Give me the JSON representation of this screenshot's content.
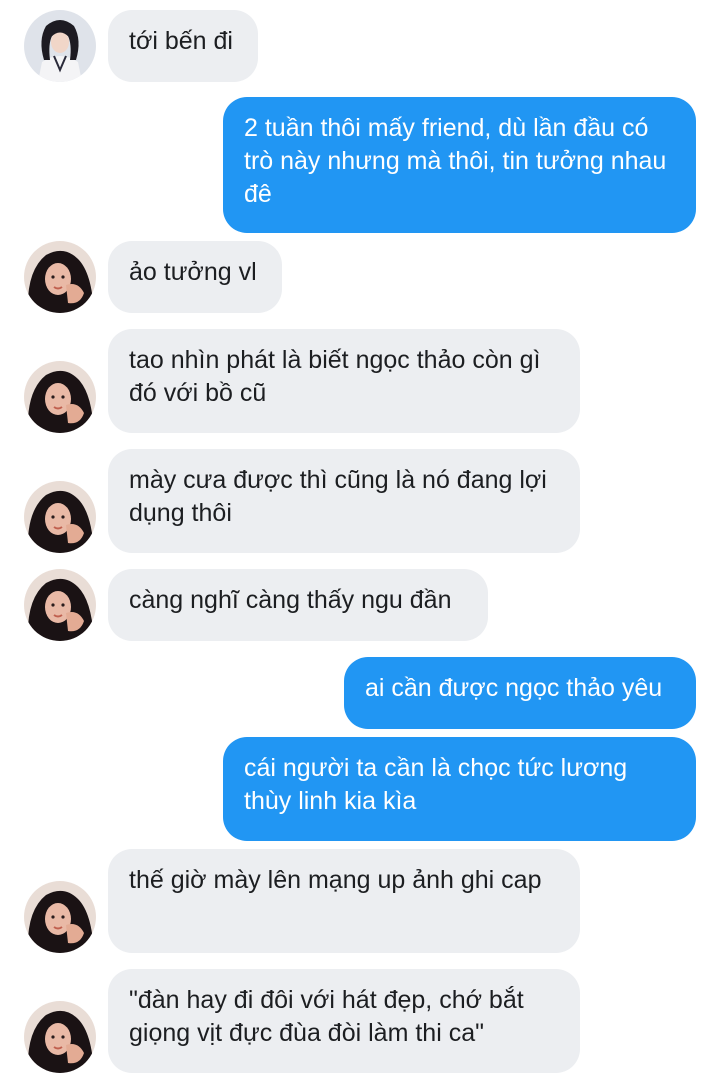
{
  "contact": {
    "avatar_first_icon": "girl-with-bangs-avatar-icon",
    "avatar_icon": "woman-portrait-avatar-icon"
  },
  "colors": {
    "incoming_bubble": "#eceef1",
    "outgoing_bubble": "#2196f3",
    "incoming_text": "#1c1e21",
    "outgoing_text": "#ffffff"
  },
  "messages": [
    {
      "side": "in",
      "text": "tới bến đi"
    },
    {
      "side": "out",
      "text": "2 tuần thôi mấy friend, dù lần đầu có trò này nhưng mà thôi, tin tưởng nhau đê"
    },
    {
      "side": "in",
      "text": "ảo tưởng vl"
    },
    {
      "side": "in",
      "text": "tao nhìn phát là biết ngọc thảo còn gì đó với bồ cũ"
    },
    {
      "side": "in",
      "text": "mày cưa được thì cũng là nó đang lợi dụng thôi"
    },
    {
      "side": "in",
      "text": "càng nghĩ càng thấy ngu đần"
    },
    {
      "side": "out",
      "text": "ai cần được ngọc thảo yêu"
    },
    {
      "side": "out",
      "text": "cái người ta cần là chọc tức lương thùy linh kia kìa"
    },
    {
      "side": "in",
      "text": "thế giờ mày lên mạng up ảnh ghi cap"
    },
    {
      "side": "in",
      "text": "\"đàn hay đi đôi với hát đẹp, chớ bắt giọng vịt đực đùa đòi làm thi ca\""
    }
  ]
}
